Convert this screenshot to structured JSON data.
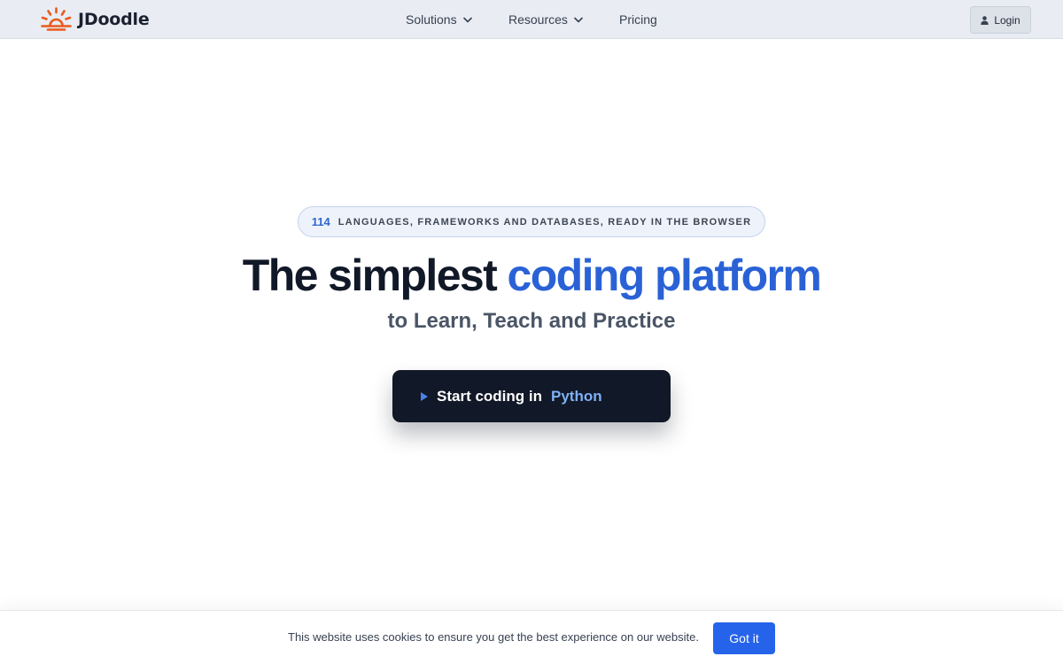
{
  "nav": {
    "brand": "JDoodle",
    "items": [
      {
        "label": "Solutions",
        "has_dropdown": true
      },
      {
        "label": "Resources",
        "has_dropdown": true
      },
      {
        "label": "Pricing",
        "has_dropdown": false
      }
    ],
    "login_label": "Login"
  },
  "hero": {
    "badge_count": "114",
    "badge_text": "LANGUAGES, FRAMEWORKS AND DATABASES, READY IN THE BROWSER",
    "headline_main": "The simplest ",
    "headline_accent": "coding platform",
    "subheadline": "to Learn, Teach and Practice",
    "cta_label": "Start coding in",
    "cta_language": "Python"
  },
  "cookie": {
    "message": "This website uses cookies to ensure you get the best experience on our website.",
    "button_label": "Got it"
  },
  "icons": {
    "logo": "sunrise-logo-icon",
    "dropdown": "chevron-down-icon",
    "login": "user-icon",
    "cta": "play-icon"
  },
  "colors": {
    "brand_orange": "#ea5a1c",
    "accent_blue": "#2a62d6",
    "cta_background": "#111827",
    "cookie_button": "#2563eb"
  }
}
